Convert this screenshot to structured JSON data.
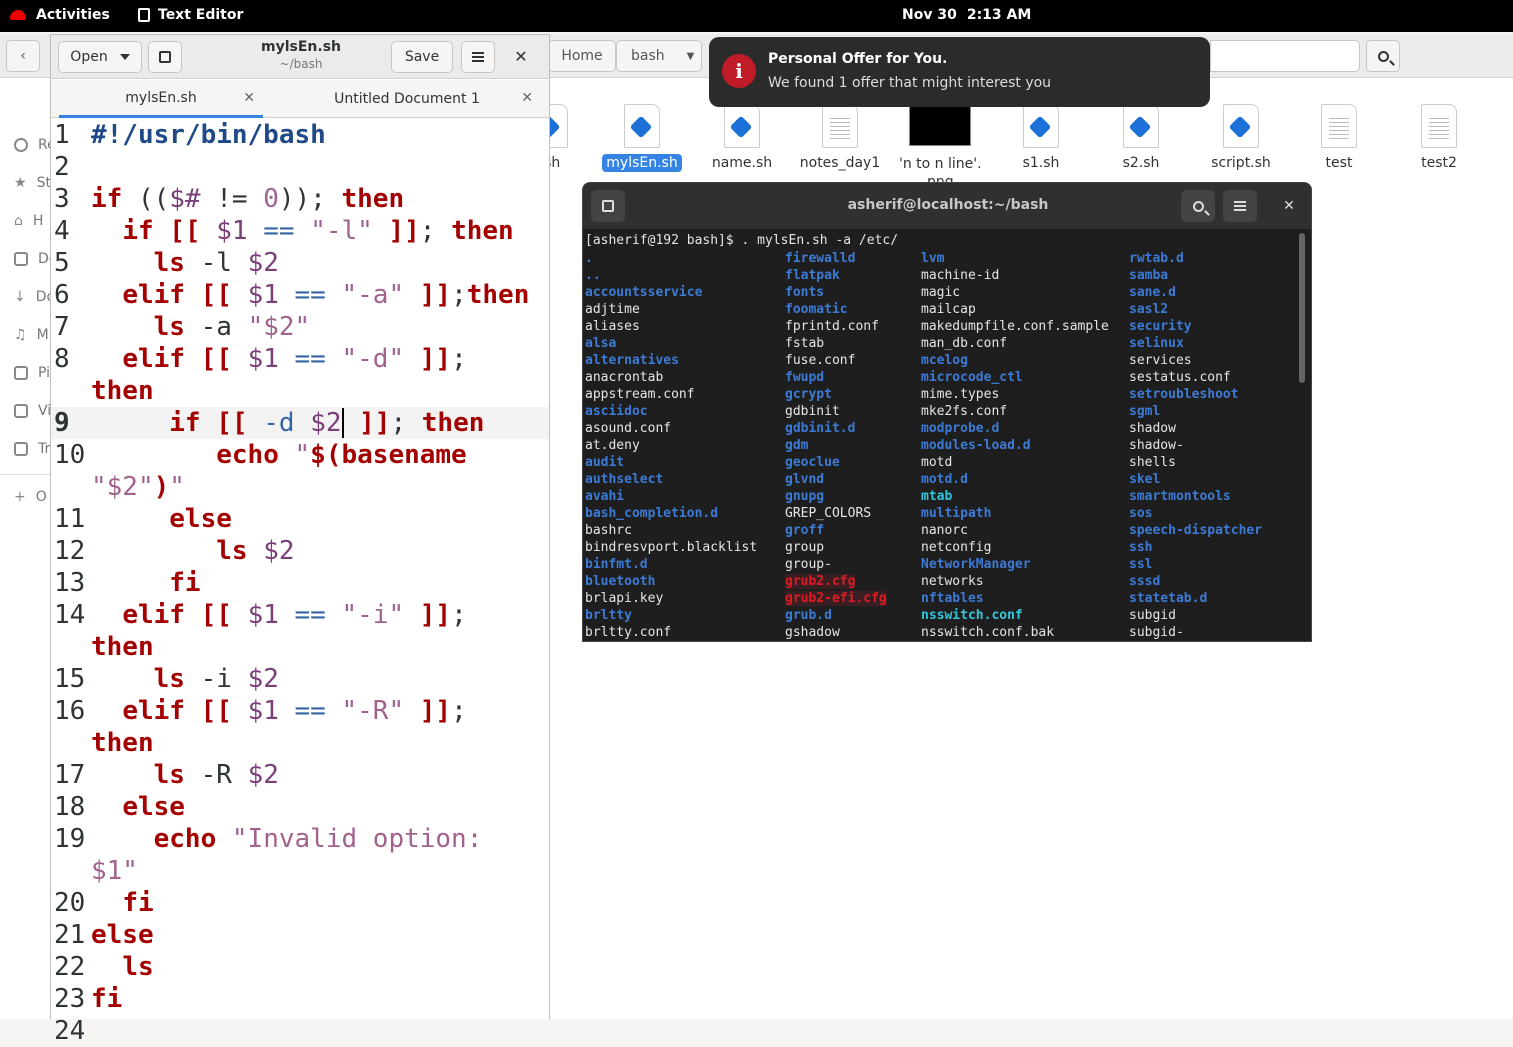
{
  "topbar": {
    "activities": "Activities",
    "app_name": "Text Editor",
    "date": "Nov 30",
    "time": "2:13 AM"
  },
  "files": {
    "path": [
      "Home",
      "bash"
    ],
    "sidebar": [
      "Re",
      "St",
      "H",
      "Do",
      "Do",
      "M",
      "Pi",
      "Vi",
      "Tr",
      "O"
    ],
    "items": [
      {
        "name": ".sh",
        "icon": "script-file-icon"
      },
      {
        "name": "mylsEn.sh",
        "icon": "script-file-icon",
        "selected": true
      },
      {
        "name": "name.sh",
        "icon": "script-file-icon"
      },
      {
        "name": "notes_day1",
        "icon": "text-file-icon"
      },
      {
        "name": "'n to n line'.\npng",
        "icon": "image-thumbnail"
      },
      {
        "name": "s1.sh",
        "icon": "script-file-icon"
      },
      {
        "name": "s2.sh",
        "icon": "script-file-icon"
      },
      {
        "name": "script.sh",
        "icon": "script-file-icon"
      },
      {
        "name": "test",
        "icon": "text-file-icon"
      },
      {
        "name": "test2",
        "icon": "text-file-icon"
      }
    ]
  },
  "notification": {
    "title": "Personal Offer for You.",
    "body": "We found 1 offer that might interest you",
    "icon": "info-icon",
    "color": "#c01c28"
  },
  "editor": {
    "open_label": "Open",
    "save_label": "Save",
    "title": "mylsEn.sh",
    "subtitle": "~/bash",
    "tabs": [
      {
        "label": "mylsEn.sh",
        "active": true
      },
      {
        "label": "Untitled Document 1",
        "active": false
      }
    ],
    "current_line": 9,
    "lines": [
      {
        "n": "1",
        "html": "<span class='sb'>#!/usr/bin/bash</span>"
      },
      {
        "n": "2",
        "html": ""
      },
      {
        "n": "3",
        "html": "<span class='kw'>if</span> ((<span class='var'>$#</span> != <span class='num'>0</span>)); <span class='kw'>then</span>"
      },
      {
        "n": "4",
        "html": "  <span class='kw'>if</span> <span class='kw'>[[</span> <span class='var'>$1</span> <span class='opt'>==</span> <span class='str'>\"-l\"</span> <span class='kw'>]]</span>; <span class='kw'>then</span>"
      },
      {
        "n": "5",
        "html": "    <span class='kw'>ls</span> -l <span class='var'>$2</span>"
      },
      {
        "n": "6",
        "html": "  <span class='kw'>elif</span> <span class='kw'>[[</span> <span class='var'>$1</span> <span class='opt'>==</span> <span class='str'>\"-a\"</span> <span class='kw'>]]</span>;<span class='kw'>then</span>"
      },
      {
        "n": "7",
        "html": "    <span class='kw'>ls</span> -a <span class='str'>\"$2\"</span>"
      },
      {
        "n": "8",
        "html": "  <span class='kw'>elif</span> <span class='kw'>[[</span> <span class='var'>$1</span> <span class='opt'>==</span> <span class='str'>\"-d\"</span> <span class='kw'>]]</span>;"
      },
      {
        "n": "",
        "html": "<span class='kw'>then</span>"
      },
      {
        "n": "9",
        "html": "     <span class='kw'>if</span> <span class='kw'>[[</span> <span class='opt'>-d</span> <span class='var'>$2</span><span class='cursor'></span> <span class='kw'>]]</span>; <span class='kw'>then</span>",
        "cur": true
      },
      {
        "n": "10",
        "html": "        <span class='kw'>echo</span> <span class='str'>\"</span><span class='kw'>$(basename</span>"
      },
      {
        "n": "",
        "html": "<span class='str'>\"$2\"</span><span class='kw'>)</span><span class='str'>\"</span>"
      },
      {
        "n": "11",
        "html": "     <span class='kw'>else</span>"
      },
      {
        "n": "12",
        "html": "        <span class='kw'>ls</span> <span class='var'>$2</span>"
      },
      {
        "n": "13",
        "html": "     <span class='kw'>fi</span>"
      },
      {
        "n": "14",
        "html": "  <span class='kw'>elif</span> <span class='kw'>[[</span> <span class='var'>$1</span> <span class='opt'>==</span> <span class='str'>\"-i\"</span> <span class='kw'>]]</span>;"
      },
      {
        "n": "",
        "html": "<span class='kw'>then</span>"
      },
      {
        "n": "15",
        "html": "    <span class='kw'>ls</span> -i <span class='var'>$2</span>"
      },
      {
        "n": "16",
        "html": "  <span class='kw'>elif</span> <span class='kw'>[[</span> <span class='var'>$1</span> <span class='opt'>==</span> <span class='str'>\"-R\"</span> <span class='kw'>]]</span>;"
      },
      {
        "n": "",
        "html": "<span class='kw'>then</span>"
      },
      {
        "n": "17",
        "html": "    <span class='kw'>ls</span> -R <span class='var'>$2</span>"
      },
      {
        "n": "18",
        "html": "  <span class='kw'>else</span>"
      },
      {
        "n": "19",
        "html": "    <span class='kw'>echo</span> <span class='str'>\"Invalid option:</span>"
      },
      {
        "n": "",
        "html": "<span class='str'>$1\"</span>"
      },
      {
        "n": "20",
        "html": "  <span class='kw'>fi</span>"
      },
      {
        "n": "21",
        "html": "<span class='kw'>else</span>"
      },
      {
        "n": "22",
        "html": "  <span class='kw'>ls</span>"
      },
      {
        "n": "23",
        "html": "<span class='kw'>fi</span>"
      },
      {
        "n": "24",
        "html": ""
      }
    ]
  },
  "terminal": {
    "title": "asherif@localhost:~/bash",
    "prompt": "[asherif@192 bash]$ . mylsEn.sh -a /etc/",
    "columns": [
      [
        {
          "t": ".",
          "c": "dir"
        },
        {
          "t": "..",
          "c": "dir"
        },
        {
          "t": "accountsservice",
          "c": "dir"
        },
        {
          "t": "adjtime",
          "c": ""
        },
        {
          "t": "aliases",
          "c": ""
        },
        {
          "t": "alsa",
          "c": "dir"
        },
        {
          "t": "alternatives",
          "c": "dir"
        },
        {
          "t": "anacrontab",
          "c": ""
        },
        {
          "t": "appstream.conf",
          "c": ""
        },
        {
          "t": "asciidoc",
          "c": "dir"
        },
        {
          "t": "asound.conf",
          "c": ""
        },
        {
          "t": "at.deny",
          "c": ""
        },
        {
          "t": "audit",
          "c": "dir"
        },
        {
          "t": "authselect",
          "c": "dir"
        },
        {
          "t": "avahi",
          "c": "dir"
        },
        {
          "t": "bash_completion.d",
          "c": "dir"
        },
        {
          "t": "bashrc",
          "c": ""
        },
        {
          "t": "bindresvport.blacklist",
          "c": ""
        },
        {
          "t": "binfmt.d",
          "c": "dir"
        },
        {
          "t": "bluetooth",
          "c": "dir"
        },
        {
          "t": "brlapi.key",
          "c": ""
        },
        {
          "t": "brltty",
          "c": "dir"
        },
        {
          "t": "brltty.conf",
          "c": ""
        }
      ],
      [
        {
          "t": "firewalld",
          "c": "dir"
        },
        {
          "t": "flatpak",
          "c": "dir"
        },
        {
          "t": "fonts",
          "c": "dir"
        },
        {
          "t": "foomatic",
          "c": "dir"
        },
        {
          "t": "fprintd.conf",
          "c": ""
        },
        {
          "t": "fstab",
          "c": ""
        },
        {
          "t": "fuse.conf",
          "c": ""
        },
        {
          "t": "fwupd",
          "c": "dir"
        },
        {
          "t": "gcrypt",
          "c": "dir"
        },
        {
          "t": "gdbinit",
          "c": ""
        },
        {
          "t": "gdbinit.d",
          "c": "dir"
        },
        {
          "t": "gdm",
          "c": "dir"
        },
        {
          "t": "geoclue",
          "c": "dir"
        },
        {
          "t": "glvnd",
          "c": "dir"
        },
        {
          "t": "gnupg",
          "c": "dir"
        },
        {
          "t": "GREP_COLORS",
          "c": ""
        },
        {
          "t": "groff",
          "c": "dir"
        },
        {
          "t": "group",
          "c": ""
        },
        {
          "t": "group-",
          "c": ""
        },
        {
          "t": "grub2.cfg",
          "c": "red"
        },
        {
          "t": "grub2-efi.cfg",
          "c": "red"
        },
        {
          "t": "grub.d",
          "c": "dir"
        },
        {
          "t": "gshadow",
          "c": ""
        }
      ],
      [
        {
          "t": "lvm",
          "c": "dir"
        },
        {
          "t": "machine-id",
          "c": ""
        },
        {
          "t": "magic",
          "c": ""
        },
        {
          "t": "mailcap",
          "c": ""
        },
        {
          "t": "makedumpfile.conf.sample",
          "c": ""
        },
        {
          "t": "man_db.conf",
          "c": ""
        },
        {
          "t": "mcelog",
          "c": "dir"
        },
        {
          "t": "microcode_ctl",
          "c": "dir"
        },
        {
          "t": "mime.types",
          "c": ""
        },
        {
          "t": "mke2fs.conf",
          "c": ""
        },
        {
          "t": "modprobe.d",
          "c": "dir"
        },
        {
          "t": "modules-load.d",
          "c": "dir"
        },
        {
          "t": "motd",
          "c": ""
        },
        {
          "t": "motd.d",
          "c": "dir"
        },
        {
          "t": "mtab",
          "c": "link"
        },
        {
          "t": "multipath",
          "c": "dir"
        },
        {
          "t": "nanorc",
          "c": ""
        },
        {
          "t": "netconfig",
          "c": ""
        },
        {
          "t": "NetworkManager",
          "c": "dir"
        },
        {
          "t": "networks",
          "c": ""
        },
        {
          "t": "nftables",
          "c": "dir"
        },
        {
          "t": "nsswitch.conf",
          "c": "link"
        },
        {
          "t": "nsswitch.conf.bak",
          "c": ""
        }
      ],
      [
        {
          "t": "rwtab.d",
          "c": "dir"
        },
        {
          "t": "samba",
          "c": "dir"
        },
        {
          "t": "sane.d",
          "c": "dir"
        },
        {
          "t": "sasl2",
          "c": "dir"
        },
        {
          "t": "security",
          "c": "dir"
        },
        {
          "t": "selinux",
          "c": "dir"
        },
        {
          "t": "services",
          "c": ""
        },
        {
          "t": "sestatus.conf",
          "c": ""
        },
        {
          "t": "setroubleshoot",
          "c": "dir"
        },
        {
          "t": "sgml",
          "c": "dir"
        },
        {
          "t": "shadow",
          "c": ""
        },
        {
          "t": "shadow-",
          "c": ""
        },
        {
          "t": "shells",
          "c": ""
        },
        {
          "t": "skel",
          "c": "dir"
        },
        {
          "t": "smartmontools",
          "c": "dir"
        },
        {
          "t": "sos",
          "c": "dir"
        },
        {
          "t": "speech-dispatcher",
          "c": "dir"
        },
        {
          "t": "ssh",
          "c": "dir"
        },
        {
          "t": "ssl",
          "c": "dir"
        },
        {
          "t": "sssd",
          "c": "dir"
        },
        {
          "t": "statetab.d",
          "c": "dir"
        },
        {
          "t": "subgid",
          "c": ""
        },
        {
          "t": "subgid-",
          "c": ""
        }
      ]
    ]
  },
  "colors": {
    "accent": "#3584e4",
    "keyword": "#a40000",
    "string": "#a2628e",
    "terminal_bg": "#1e1e1e",
    "dir": "#3c7bd6"
  }
}
